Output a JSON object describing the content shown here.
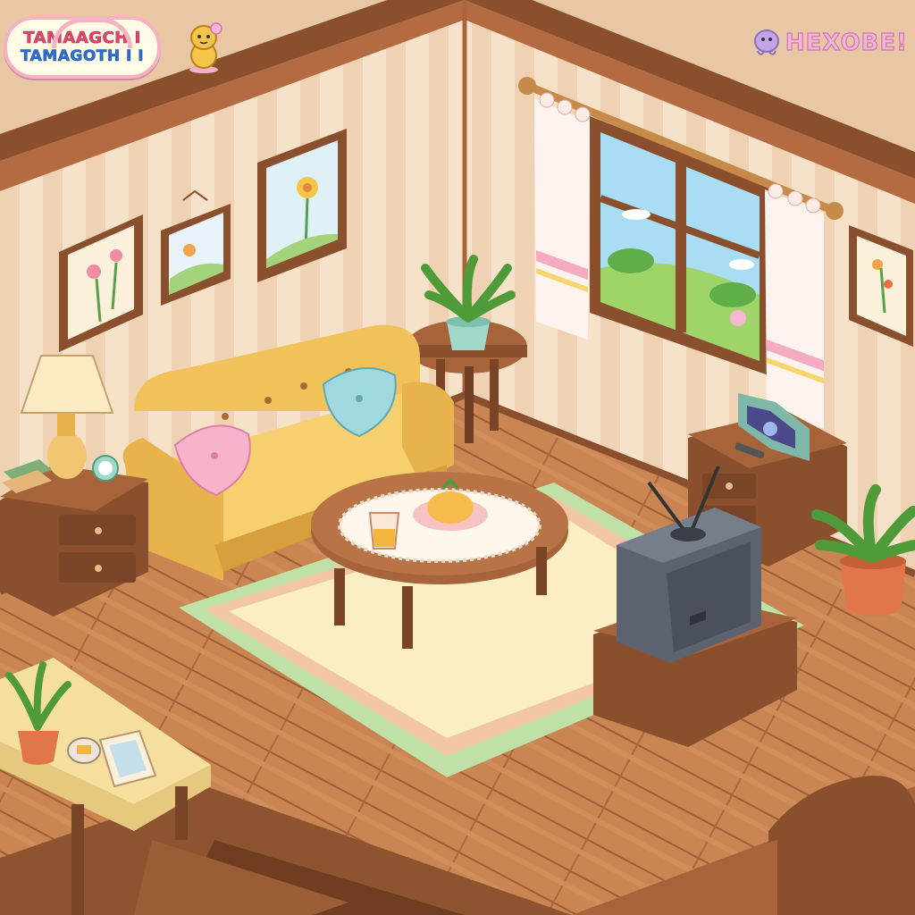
{
  "game": {
    "logo_line1": "TAMAAGCH I",
    "logo_line2": "TAMAGOTH I I",
    "brand": "HEXOBE!"
  },
  "scene": {
    "room": "living-room",
    "colors": {
      "wall": "#f4dcc0",
      "wall_stripe": "#ecc9a7",
      "floor": "#c98552",
      "rug": "#fbeec2",
      "sofa": "#f2c25a",
      "wood": "#8a4f2d"
    }
  }
}
